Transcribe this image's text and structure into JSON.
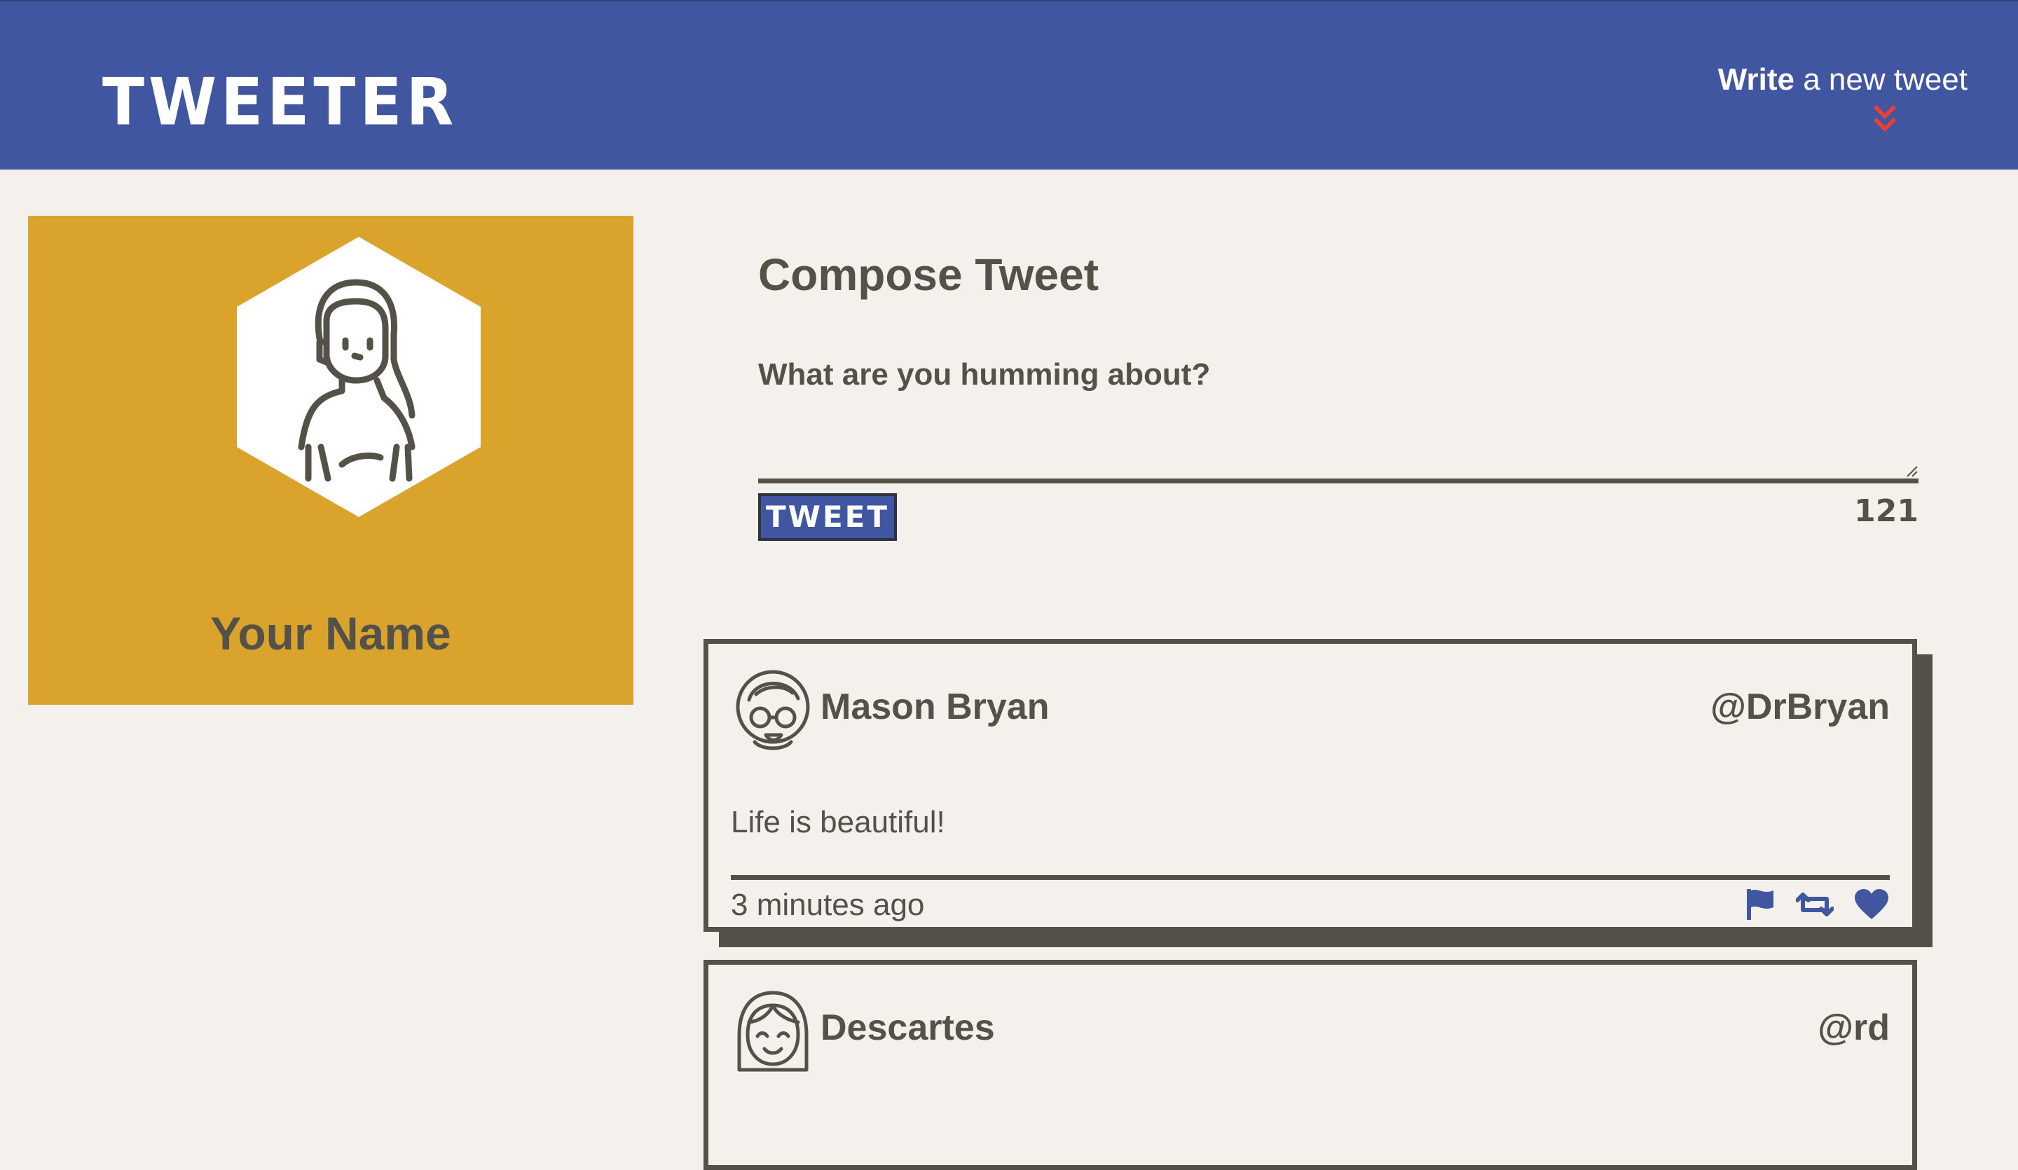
{
  "nav": {
    "brand": "TWEETER",
    "new_tweet_strong": "Write",
    "new_tweet_rest": " a new tweet",
    "new_tweet_icon": "double-chevron-down-icon",
    "colors": {
      "nav_bg": "#4056a1",
      "chevron": "#e4413d"
    }
  },
  "profile": {
    "name": "Your Name",
    "avatar_icon": "user-female-avatar-icon",
    "colors": {
      "card_bg": "#d9a32c"
    }
  },
  "compose": {
    "title": "Compose Tweet",
    "label": "What are you humming about?",
    "textarea_value": "",
    "button_label": "TWEET",
    "counter": "121"
  },
  "tweets": [
    {
      "name": "Mason Bryan",
      "handle": "@DrBryan",
      "content": "Life is beautiful!",
      "time": "3 minutes ago",
      "avatar_icon": "man-with-glasses-avatar-icon",
      "actions": [
        "flag-icon",
        "retweet-icon",
        "heart-icon"
      ]
    },
    {
      "name": "Descartes",
      "handle": "@rd",
      "avatar_icon": "smiling-person-avatar-icon"
    }
  ]
}
